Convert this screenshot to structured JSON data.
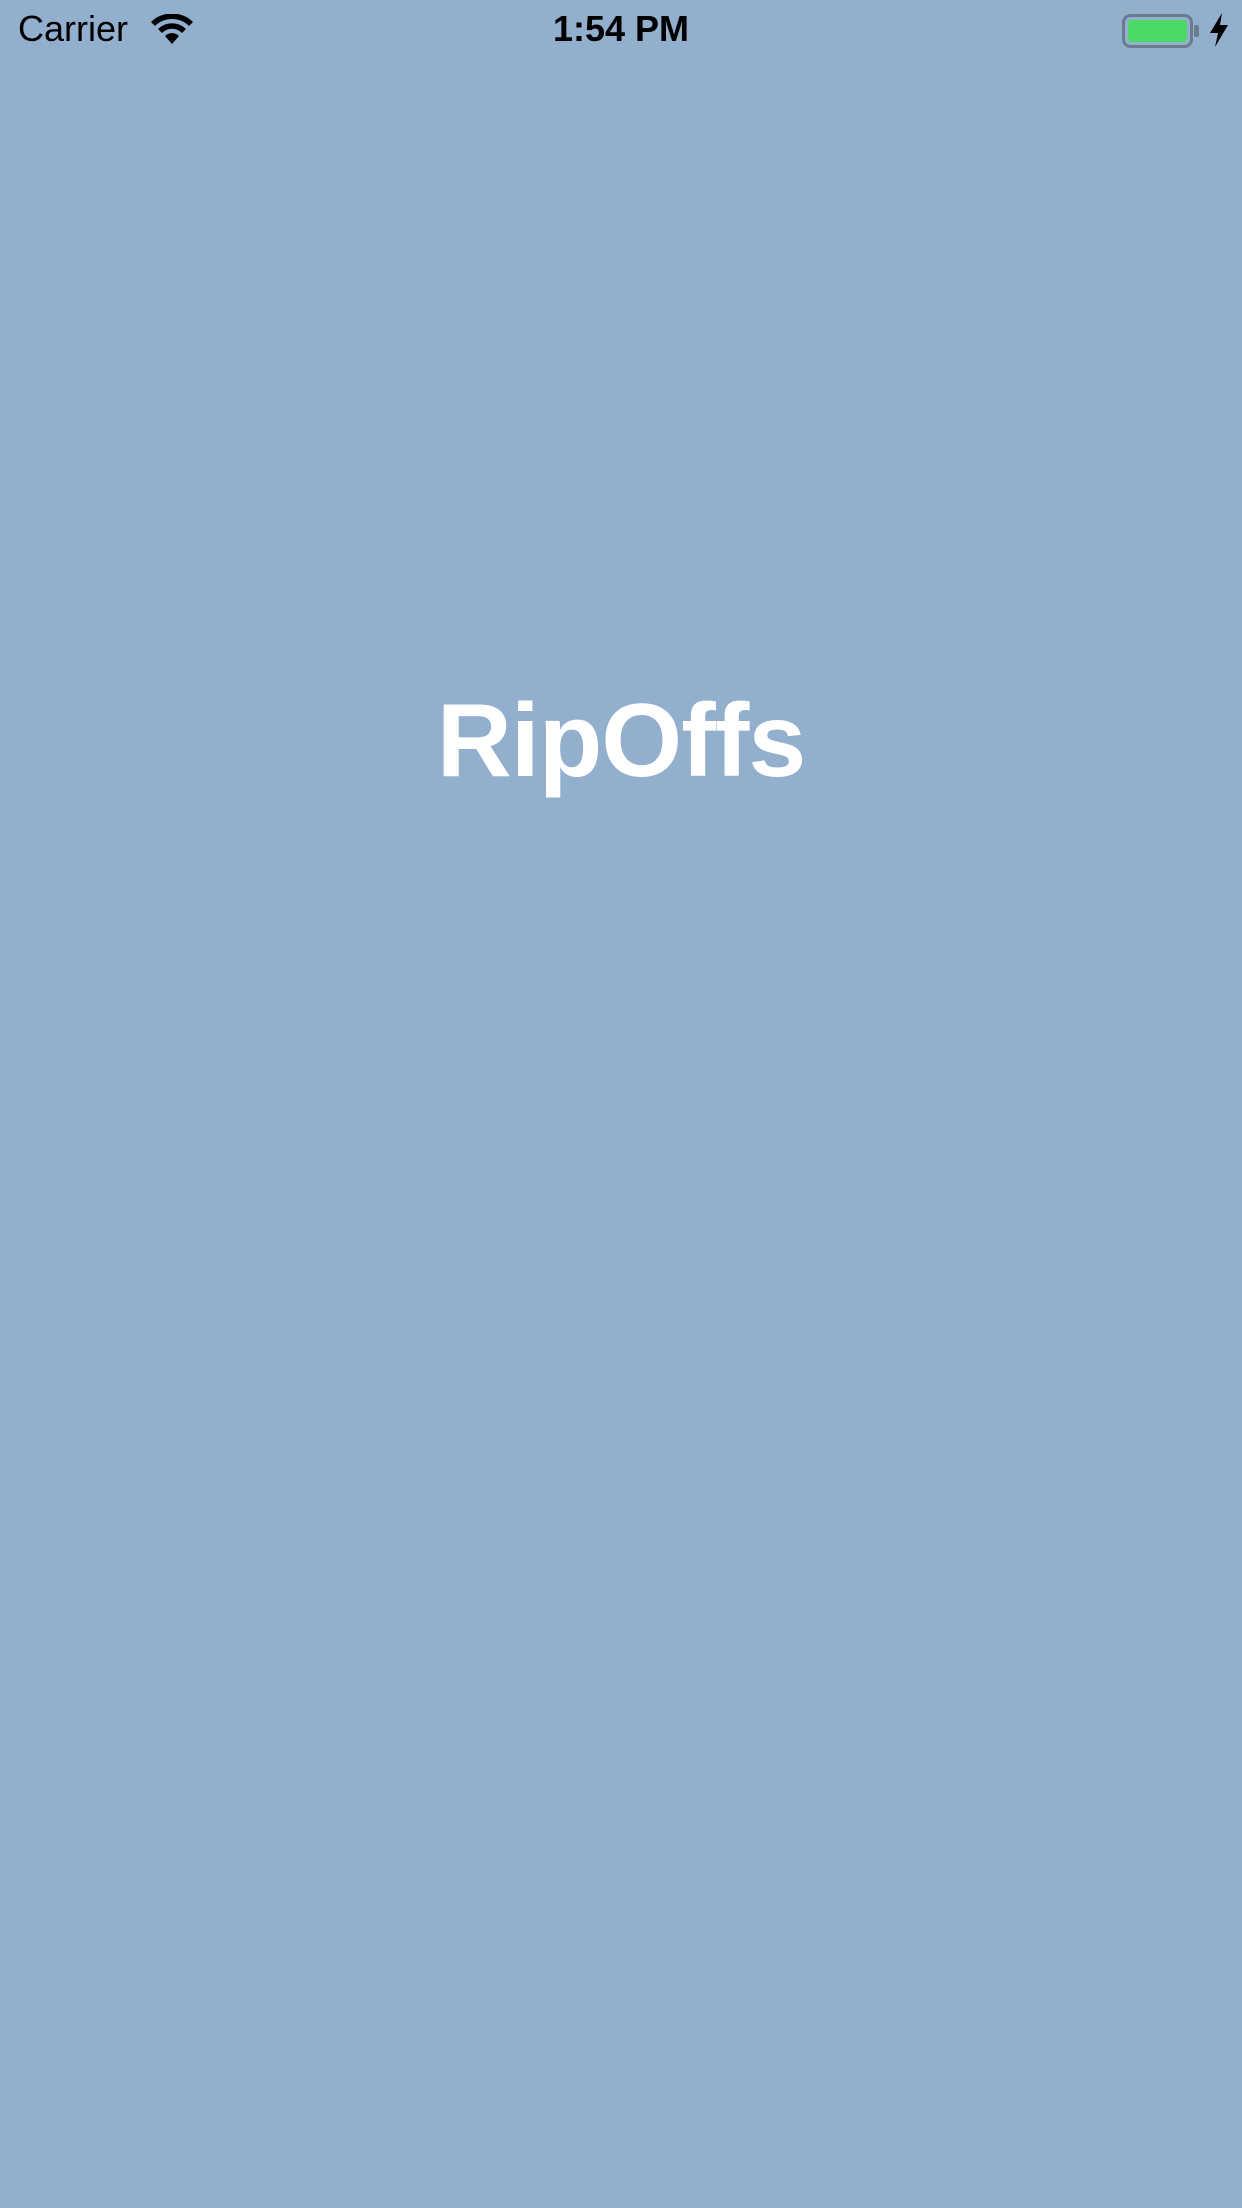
{
  "status_bar": {
    "carrier": "Carrier",
    "time": "1:54 PM",
    "icons": [
      "wifi-icon",
      "battery-icon",
      "charging-bolt-icon"
    ]
  },
  "splash": {
    "title": "RipOffs"
  },
  "colors": {
    "background": "#92AFCE",
    "title": "#FFFFFF",
    "battery_fill": "#4CD964"
  }
}
